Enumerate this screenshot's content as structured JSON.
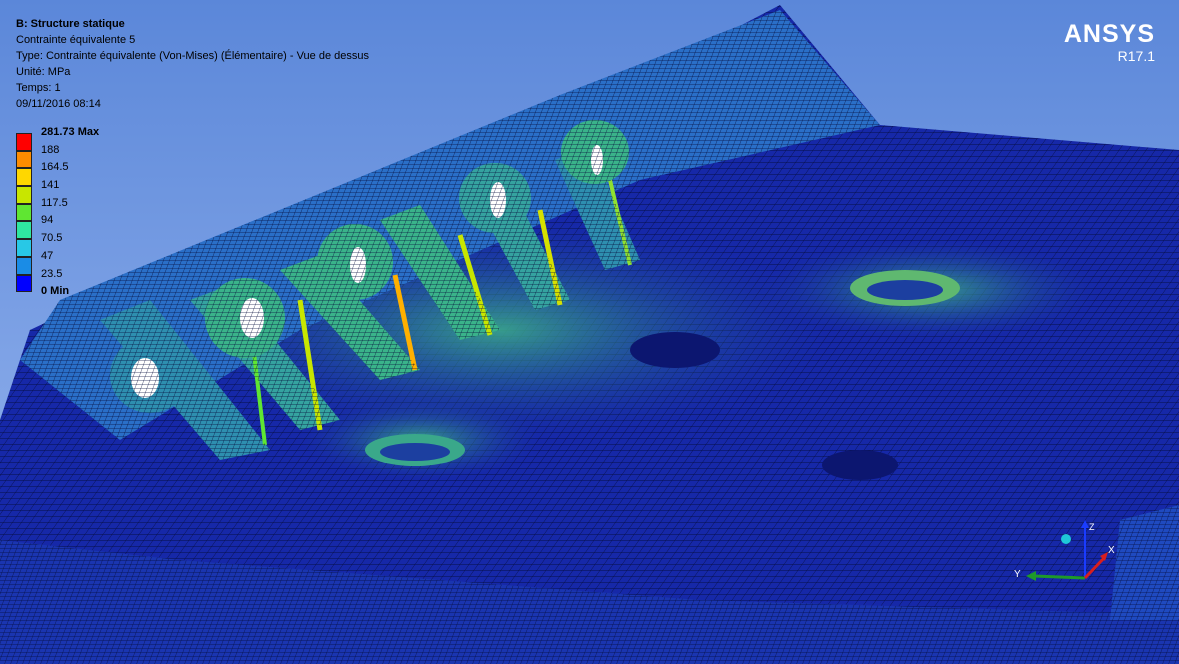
{
  "header": {
    "analysis": "B: Structure statique",
    "result": "Contrainte équivalente 5",
    "type": "Type: Contrainte équivalente (Von-Mises) (Élémentaire) - Vue de dessus",
    "unit": "Unité: MPa",
    "time": "Temps: 1",
    "date": "09/11/2016 08:14"
  },
  "legend": {
    "max_label": "281.73 Max",
    "min_label": "0 Min",
    "ticks": [
      "188",
      "164.5",
      "141",
      "117.5",
      "94",
      "70.5",
      "47",
      "23.5"
    ],
    "colors": [
      "#ff0000",
      "#ff8c00",
      "#ffd700",
      "#c8e600",
      "#5fe632",
      "#2fe6a0",
      "#28c8e6",
      "#1a8ce6",
      "#0000ff"
    ]
  },
  "brand": {
    "name": "ANSYS",
    "version": "R17.1"
  },
  "triad": {
    "x_label": "X",
    "y_label": "Y",
    "z_label": "Z"
  }
}
